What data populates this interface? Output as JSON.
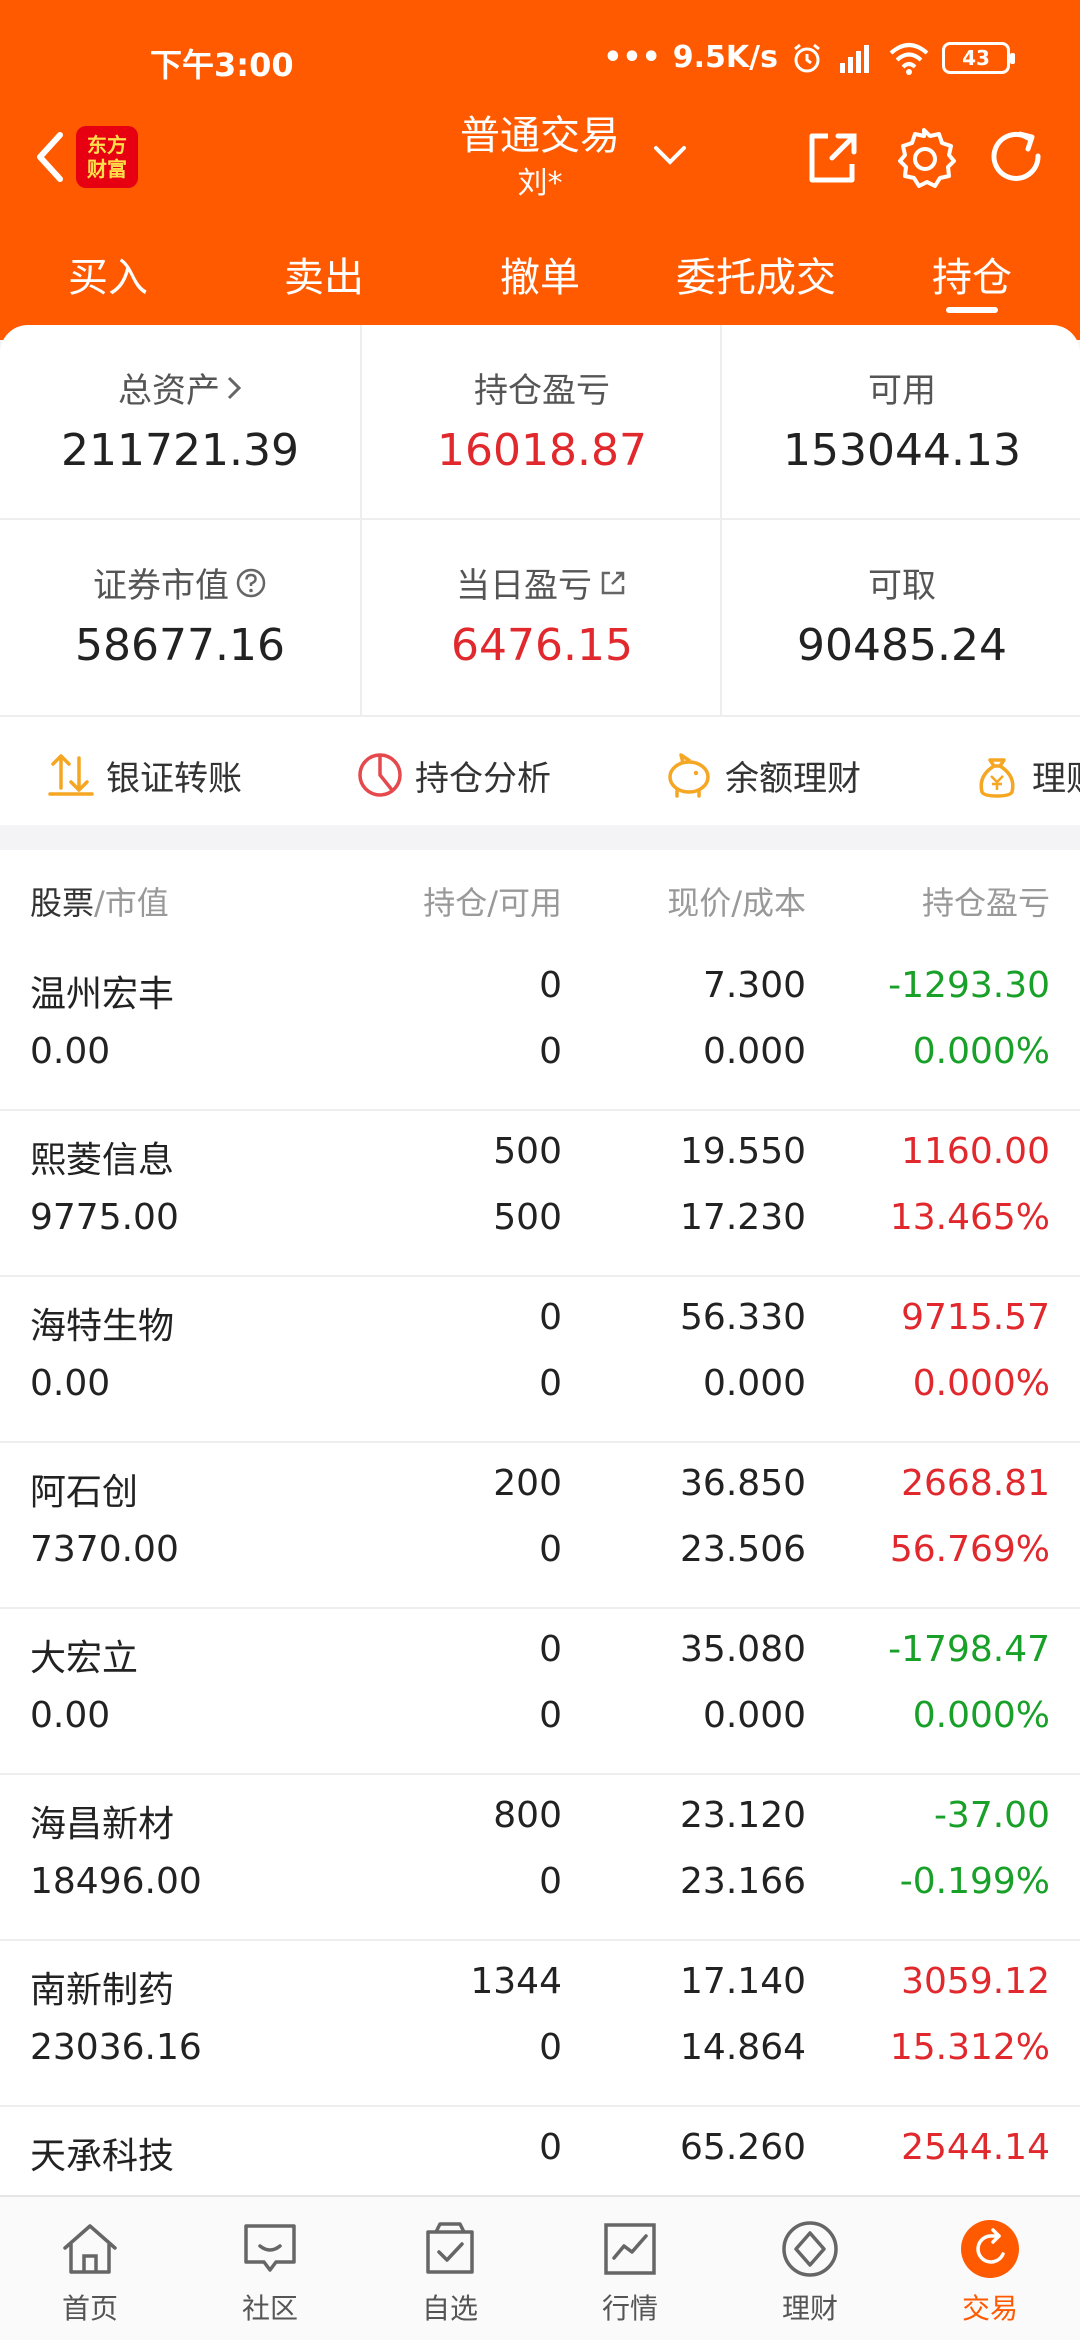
{
  "status_bar": {
    "time": "下午3:00",
    "net_speed": "9.5K/s",
    "battery": "43"
  },
  "header": {
    "title": "普通交易",
    "subtitle": "刘*",
    "logo_line1": "东方",
    "logo_line2": "财富"
  },
  "tabs": [
    {
      "label": "买入"
    },
    {
      "label": "卖出"
    },
    {
      "label": "撤单"
    },
    {
      "label": "委托成交"
    },
    {
      "label": "持仓"
    }
  ],
  "summary": {
    "total_assets_label": "总资产",
    "total_assets": "211721.39",
    "position_pnl_label": "持仓盈亏",
    "position_pnl": "16018.87",
    "available_label": "可用",
    "available": "153044.13",
    "market_value_label": "证券市值",
    "market_value": "58677.16",
    "daily_pnl_label": "当日盈亏",
    "daily_pnl": "6476.15",
    "withdrawable_label": "可取",
    "withdrawable": "90485.24"
  },
  "actions": [
    {
      "label": "银证转账"
    },
    {
      "label": "持仓分析"
    },
    {
      "label": "余额理财"
    },
    {
      "label": "理财"
    }
  ],
  "table": {
    "header_stock": "股票",
    "header_mv": "/市值",
    "header_qty": "持仓/可用",
    "header_price": "现价/成本",
    "header_pnl": "持仓盈亏",
    "rows": [
      {
        "name": "温州宏丰",
        "market_value": "0.00",
        "qty": "0",
        "available": "0",
        "price": "7.300",
        "cost": "0.000",
        "pnl": "-1293.30",
        "pct": "0.000%",
        "dir": "down"
      },
      {
        "name": "熙菱信息",
        "market_value": "9775.00",
        "qty": "500",
        "available": "500",
        "price": "19.550",
        "cost": "17.230",
        "pnl": "1160.00",
        "pct": "13.465%",
        "dir": "up"
      },
      {
        "name": "海特生物",
        "market_value": "0.00",
        "qty": "0",
        "available": "0",
        "price": "56.330",
        "cost": "0.000",
        "pnl": "9715.57",
        "pct": "0.000%",
        "dir": "up"
      },
      {
        "name": "阿石创",
        "market_value": "7370.00",
        "qty": "200",
        "available": "0",
        "price": "36.850",
        "cost": "23.506",
        "pnl": "2668.81",
        "pct": "56.769%",
        "dir": "up"
      },
      {
        "name": "大宏立",
        "market_value": "0.00",
        "qty": "0",
        "available": "0",
        "price": "35.080",
        "cost": "0.000",
        "pnl": "-1798.47",
        "pct": "0.000%",
        "dir": "down"
      },
      {
        "name": "海昌新材",
        "market_value": "18496.00",
        "qty": "800",
        "available": "0",
        "price": "23.120",
        "cost": "23.166",
        "pnl": "-37.00",
        "pct": "-0.199%",
        "dir": "down"
      },
      {
        "name": "南新制药",
        "market_value": "23036.16",
        "qty": "1344",
        "available": "0",
        "price": "17.140",
        "cost": "14.864",
        "pnl": "3059.12",
        "pct": "15.312%",
        "dir": "up"
      },
      {
        "name": "天承科技",
        "market_value": "",
        "qty": "0",
        "available": "",
        "price": "65.260",
        "cost": "",
        "pnl": "2544.14",
        "pct": "",
        "dir": "up"
      }
    ]
  },
  "bottom_nav": [
    {
      "label": "首页",
      "icon": "home-icon"
    },
    {
      "label": "社区",
      "icon": "chat-icon"
    },
    {
      "label": "自选",
      "icon": "checklist-icon"
    },
    {
      "label": "行情",
      "icon": "chart-icon"
    },
    {
      "label": "理财",
      "icon": "diamond-icon"
    },
    {
      "label": "交易",
      "icon": "trade-icon"
    }
  ],
  "colors": {
    "brand_orange": "#ff5a00",
    "up_red": "#e0282d",
    "down_green": "#18a028"
  }
}
